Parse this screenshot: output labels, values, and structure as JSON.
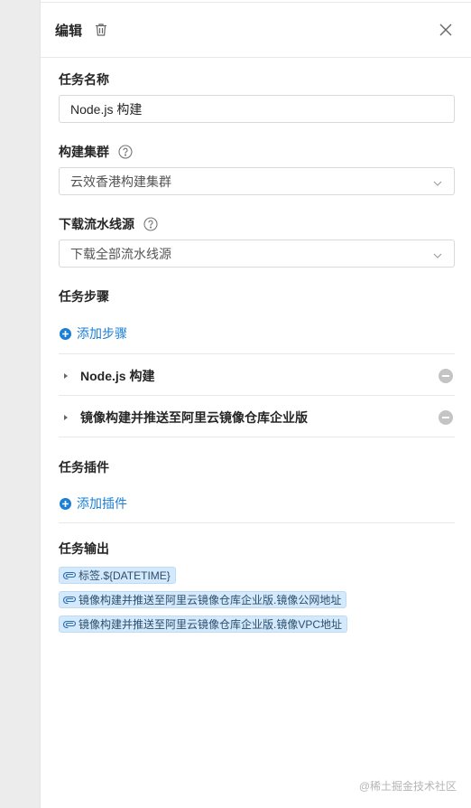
{
  "header": {
    "title": "编辑",
    "icons": {
      "delete": "trash-icon",
      "close": "close-icon"
    }
  },
  "task_name": {
    "label": "任务名称",
    "value": "Node.js 构建"
  },
  "cluster": {
    "label": "构建集群",
    "selected": "云效香港构建集群",
    "help_icon": "question-circle-icon"
  },
  "download_source": {
    "label": "下载流水线源",
    "selected": "下载全部流水线源",
    "help_icon": "question-circle-icon"
  },
  "steps": {
    "label": "任务步骤",
    "add_label": "添加步骤",
    "items": [
      {
        "label": "Node.js 构建"
      },
      {
        "label": "镜像构建并推送至阿里云镜像仓库企业版"
      }
    ]
  },
  "plugins": {
    "label": "任务插件",
    "add_label": "添加插件"
  },
  "outputs": {
    "label": "任务输出",
    "tags": [
      {
        "label": "标签.${DATETIME}"
      },
      {
        "label": "镜像构建并推送至阿里云镜像仓库企业版.镜像公网地址"
      },
      {
        "label": "镜像构建并推送至阿里云镜像仓库企业版.镜像VPC地址"
      }
    ]
  },
  "watermark": "@稀土掘金技术社区",
  "colors": {
    "accent": "#1b7fd6",
    "tag_background": "#d4e9fb",
    "remove_icon": "#c4c4c4",
    "backdrop": "#ececec"
  }
}
